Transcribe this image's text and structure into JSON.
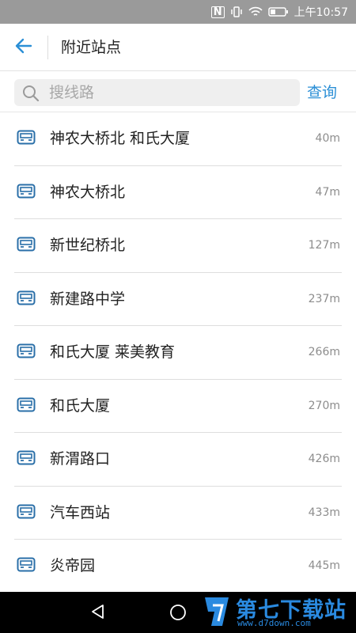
{
  "status_bar": {
    "nfc": "N",
    "time": "上午10:57"
  },
  "header": {
    "title": "附近站点",
    "back_icon": "arrow-left-icon",
    "accent_color": "#2b8fd6"
  },
  "search": {
    "placeholder": "搜线路",
    "value": "",
    "button_label": "查询"
  },
  "stations": [
    {
      "name": "神农大桥北 和氏大厦",
      "distance": "40m"
    },
    {
      "name": "神农大桥北",
      "distance": "47m"
    },
    {
      "name": "新世纪桥北",
      "distance": "127m"
    },
    {
      "name": "新建路中学",
      "distance": "237m"
    },
    {
      "name": "和氏大厦 莱美教育",
      "distance": "266m"
    },
    {
      "name": "和氏大厦",
      "distance": "270m"
    },
    {
      "name": "新渭路口",
      "distance": "426m"
    },
    {
      "name": "汽车西站",
      "distance": "433m"
    },
    {
      "name": "炎帝园",
      "distance": "445m"
    }
  ],
  "station_icon": "bus-stop-icon",
  "watermark": {
    "text": "第七下载站",
    "url": "www.d7down.com"
  }
}
